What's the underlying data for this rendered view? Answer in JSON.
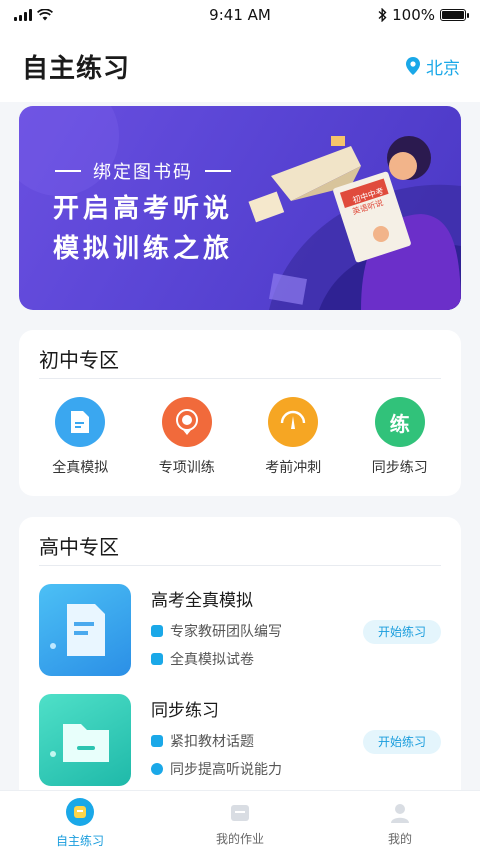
{
  "status_bar": {
    "time": "9:41 AM",
    "battery": "100%"
  },
  "header": {
    "title": "自主练习",
    "location": "北京"
  },
  "banner": {
    "subtitle": "绑定图书码",
    "line1": "开启高考听说",
    "line2": "模拟训练之旅",
    "book_title_line1": "初中中考",
    "book_title_line2": "英语听说"
  },
  "junior": {
    "title": "初中专区",
    "items": [
      {
        "label": "全真模拟",
        "icon": "doc-icon",
        "color": "#3aa7f0"
      },
      {
        "label": "专项训练",
        "icon": "target-icon",
        "color": "#f16a3b"
      },
      {
        "label": "考前冲刺",
        "icon": "gauge-icon",
        "color": "#f6a623"
      },
      {
        "label": "同步练习",
        "icon": "practice-icon",
        "glyph": "练",
        "color": "#31c27a"
      }
    ]
  },
  "senior": {
    "title": "高中专区",
    "courses": [
      {
        "title": "高考全真模拟",
        "features": [
          "专家教研团队编写",
          "全真模拟试卷"
        ],
        "button": "开始练习"
      },
      {
        "title": "同步练习",
        "features": [
          "紧扣教材话题",
          "同步提高听说能力"
        ],
        "button": "开始练习"
      }
    ]
  },
  "tabbar": {
    "tabs": [
      {
        "label": "自主练习",
        "active": true
      },
      {
        "label": "我的作业",
        "active": false
      },
      {
        "label": "我的",
        "active": false
      }
    ]
  },
  "colors": {
    "accent": "#1aa8e8",
    "banner": "#5b46d6"
  }
}
